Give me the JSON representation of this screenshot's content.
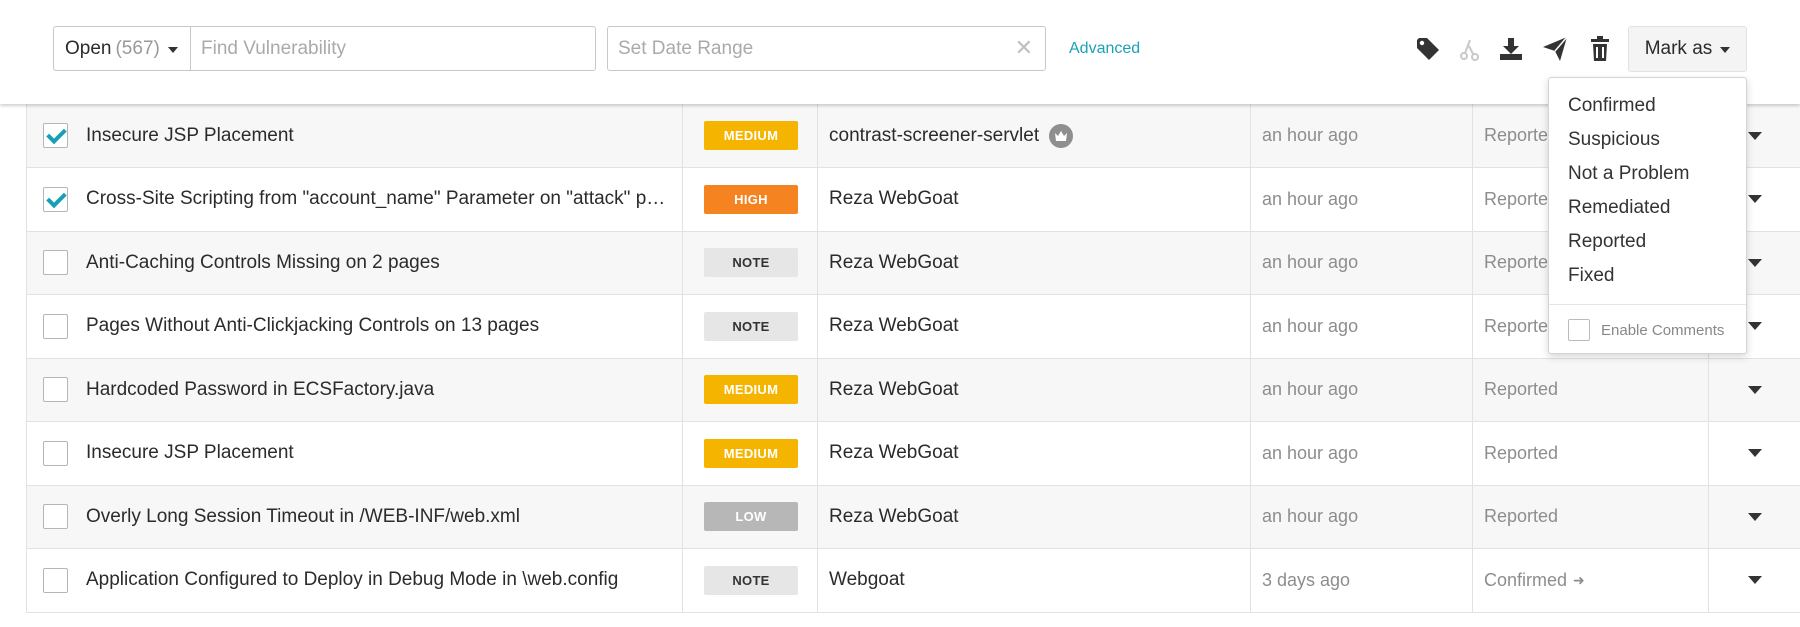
{
  "toolbar": {
    "status_filter": {
      "label": "Open",
      "count": "(567)"
    },
    "search": {
      "placeholder": "Find Vulnerability",
      "value": ""
    },
    "date_range": {
      "placeholder": "Set Date Range",
      "value": ""
    },
    "advanced_label": "Advanced",
    "icons": [
      "tag-icon",
      "merge-icon",
      "download-icon",
      "send-icon",
      "trash-icon"
    ],
    "mark_as_label": "Mark as"
  },
  "mark_as_menu": {
    "items": [
      "Confirmed",
      "Suspicious",
      "Not a Problem",
      "Remediated",
      "Reported",
      "Fixed"
    ],
    "enable_comments_label": "Enable Comments"
  },
  "colors": {
    "accent": "#1aa2b8",
    "medium": "#f5b400",
    "high": "#f58320",
    "note": "#e6e6e6",
    "low": "#b7b7b7"
  },
  "rows": [
    {
      "checked": true,
      "title": "Insecure JSP Placement",
      "severity": "MEDIUM",
      "severity_class": "medium",
      "application": "contrast-screener-servlet",
      "merged": true,
      "discovered": "an hour ago",
      "status": "Reported"
    },
    {
      "checked": true,
      "title": "Cross-Site Scripting from \"account_name\" Parameter on \"attack\" pag…",
      "severity": "HIGH",
      "severity_class": "high",
      "application": "Reza WebGoat",
      "merged": false,
      "discovered": "an hour ago",
      "status": "Reported"
    },
    {
      "checked": false,
      "title": "Anti-Caching Controls Missing on 2 pages",
      "severity": "NOTE",
      "severity_class": "note",
      "application": "Reza WebGoat",
      "merged": false,
      "discovered": "an hour ago",
      "status": "Reported"
    },
    {
      "checked": false,
      "title": "Pages Without Anti-Clickjacking Controls on 13 pages",
      "severity": "NOTE",
      "severity_class": "note",
      "application": "Reza WebGoat",
      "merged": false,
      "discovered": "an hour ago",
      "status": "Reported"
    },
    {
      "checked": false,
      "title": "Hardcoded Password in ECSFactory.java",
      "severity": "MEDIUM",
      "severity_class": "medium",
      "application": "Reza WebGoat",
      "merged": false,
      "discovered": "an hour ago",
      "status": "Reported"
    },
    {
      "checked": false,
      "title": "Insecure JSP Placement",
      "severity": "MEDIUM",
      "severity_class": "medium",
      "application": "Reza WebGoat",
      "merged": false,
      "discovered": "an hour ago",
      "status": "Reported"
    },
    {
      "checked": false,
      "title": "Overly Long Session Timeout in /WEB-INF/web.xml",
      "severity": "LOW",
      "severity_class": "low",
      "application": "Reza WebGoat",
      "merged": false,
      "discovered": "an hour ago",
      "status": "Reported"
    },
    {
      "checked": false,
      "title": "Application Configured to Deploy in Debug Mode in \\web.config",
      "severity": "NOTE",
      "severity_class": "note",
      "application": "Webgoat",
      "merged": false,
      "discovered": "3 days ago",
      "status": "Confirmed",
      "status_arrow": true
    }
  ]
}
